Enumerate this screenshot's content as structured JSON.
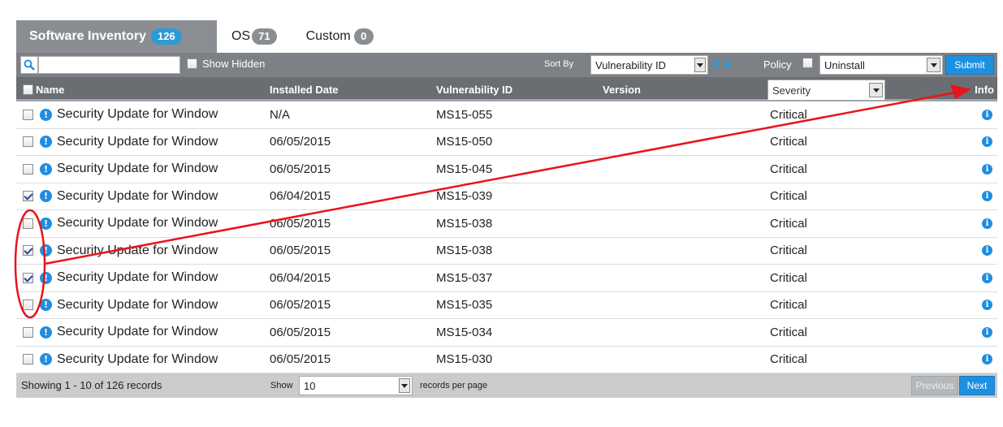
{
  "tabs": [
    {
      "label": "Software Inventory",
      "count": "126"
    },
    {
      "label": "OS",
      "count": "71"
    },
    {
      "label": "Custom",
      "count": "0"
    }
  ],
  "toolbar": {
    "search_placeholder": "",
    "show_hidden_label": "Show Hidden",
    "sort_by_label": "Sort By",
    "sort_by_value": "Vulnerability ID",
    "policy_label": "Policy",
    "policy_value": "Uninstall",
    "submit_label": "Submit"
  },
  "columns": {
    "name": "Name",
    "installed_date": "Installed Date",
    "vulnerability_id": "Vulnerability ID",
    "version": "Version",
    "severity": "Severity",
    "info": "Info"
  },
  "rows": [
    {
      "name": "Security Update for Window",
      "date": "N/A",
      "vuln": "MS15-055",
      "version": "",
      "severity": "Critical",
      "checked": false
    },
    {
      "name": "Security Update for Window",
      "date": "06/05/2015",
      "vuln": "MS15-050",
      "version": "",
      "severity": "Critical",
      "checked": false
    },
    {
      "name": "Security Update for Window",
      "date": "06/05/2015",
      "vuln": "MS15-045",
      "version": "",
      "severity": "Critical",
      "checked": false
    },
    {
      "name": "Security Update for Window",
      "date": "06/04/2015",
      "vuln": "MS15-039",
      "version": "",
      "severity": "Critical",
      "checked": true
    },
    {
      "name": "Security Update for Window",
      "date": "06/05/2015",
      "vuln": "MS15-038",
      "version": "",
      "severity": "Critical",
      "checked": false
    },
    {
      "name": "Security Update for Window",
      "date": "06/05/2015",
      "vuln": "MS15-038",
      "version": "",
      "severity": "Critical",
      "checked": true
    },
    {
      "name": "Security Update for Window",
      "date": "06/04/2015",
      "vuln": "MS15-037",
      "version": "",
      "severity": "Critical",
      "checked": true
    },
    {
      "name": "Security Update for Window",
      "date": "06/05/2015",
      "vuln": "MS15-035",
      "version": "",
      "severity": "Critical",
      "checked": false
    },
    {
      "name": "Security Update for Window",
      "date": "06/05/2015",
      "vuln": "MS15-034",
      "version": "",
      "severity": "Critical",
      "checked": false
    },
    {
      "name": "Security Update for Window",
      "date": "06/05/2015",
      "vuln": "MS15-030",
      "version": "",
      "severity": "Critical",
      "checked": false
    }
  ],
  "footer": {
    "showing": "Showing 1 - 10 of 126 records",
    "show_label": "Show",
    "per_page_value": "10",
    "per_page_label": "records per page",
    "previous_label": "Previous",
    "next_label": "Next"
  },
  "colors": {
    "accent": "#1e90e0",
    "annotation": "#e8141a"
  },
  "icons": [
    "search-icon",
    "sort-arrows-icon",
    "alert-icon",
    "info-icon",
    "chevron-down-icon"
  ]
}
